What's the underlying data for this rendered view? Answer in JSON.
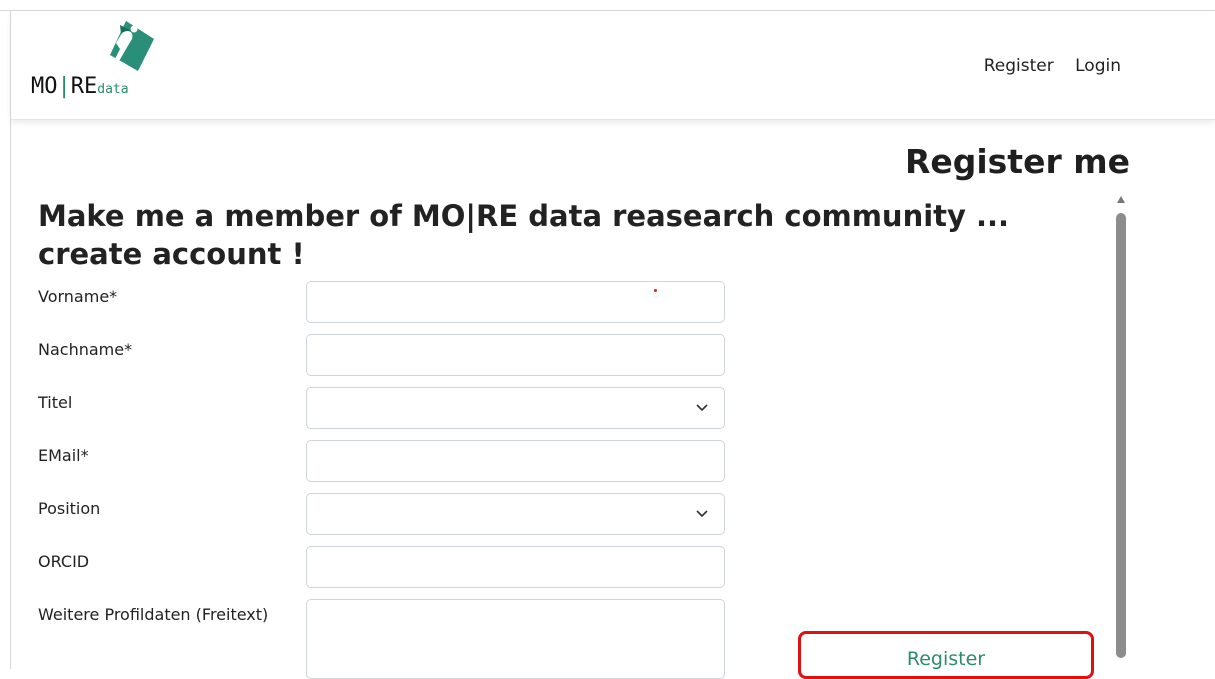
{
  "brand": {
    "logo_text_main": "MO",
    "logo_text_bar": "|",
    "logo_text_main2": "RE",
    "logo_text_sub": "data",
    "icon": "more-data-logo-icon"
  },
  "nav": {
    "register_label": "Register",
    "login_label": "Login"
  },
  "page": {
    "title": "Register me",
    "heading": "Make me a member of MO|RE data reasearch community ... create account !"
  },
  "form": {
    "vorname": {
      "label": "Vorname*",
      "value": ""
    },
    "nachname": {
      "label": "Nachname*",
      "value": ""
    },
    "titel": {
      "label": "Titel",
      "value": ""
    },
    "email": {
      "label": "EMail*",
      "value": ""
    },
    "position": {
      "label": "Position",
      "value": ""
    },
    "orcid": {
      "label": "ORCID",
      "value": ""
    },
    "weitere": {
      "label": "Weitere Profildaten (Freitext)",
      "value": ""
    },
    "submit_label": "Register"
  },
  "colors": {
    "accent": "#2c8c6a",
    "highlight": "#e01010"
  }
}
